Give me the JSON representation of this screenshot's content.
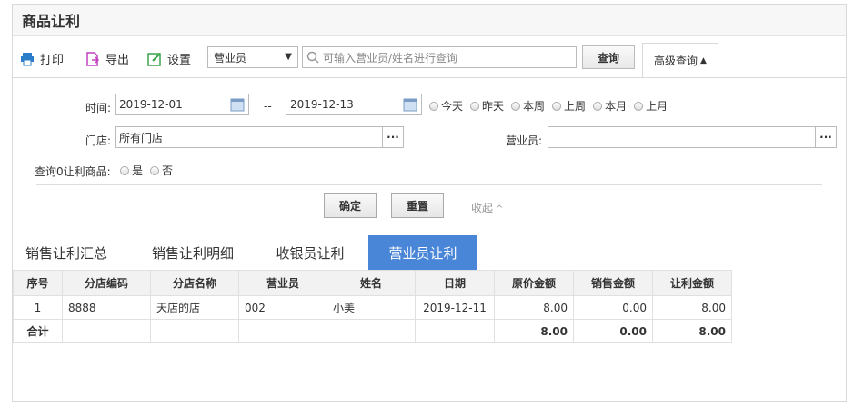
{
  "title": "商品让利",
  "toolbar": {
    "print": "打印",
    "export": "导出",
    "settings": "设置",
    "select_value": "营业员",
    "search_placeholder": "可输入营业员/姓名进行查询",
    "query": "查询",
    "advanced": "高级查询"
  },
  "filters": {
    "time_label": "时间:",
    "date_from": "2019-12-01",
    "range_sep": "--",
    "date_to": "2019-12-13",
    "quick": [
      "今天",
      "昨天",
      "本周",
      "上周",
      "本月",
      "上月"
    ],
    "store_label": "门店:",
    "store_value": "所有门店",
    "clerk_label": "营业员:",
    "clerk_value": "",
    "zero_label": "查询0让利商品:",
    "yes": "是",
    "no": "否",
    "confirm": "确定",
    "reset": "重置",
    "collapse": "收起"
  },
  "tabs": [
    "销售让利汇总",
    "销售让利明细",
    "收银员让利",
    "营业员让利"
  ],
  "active_tab": 3,
  "table": {
    "headers": [
      "序号",
      "分店编码",
      "分店名称",
      "营业员",
      "姓名",
      "日期",
      "原价金额",
      "销售金额",
      "让利金额"
    ],
    "rows": [
      [
        "1",
        "8888",
        "天店的店",
        "002",
        "小美",
        "2019-12-11",
        "8.00",
        "0.00",
        "8.00"
      ]
    ],
    "total": [
      "合计",
      "",
      "",
      "",
      "",
      "",
      "8.00",
      "0.00",
      "8.00"
    ]
  },
  "colors": {
    "accent": "#4a86d8"
  }
}
